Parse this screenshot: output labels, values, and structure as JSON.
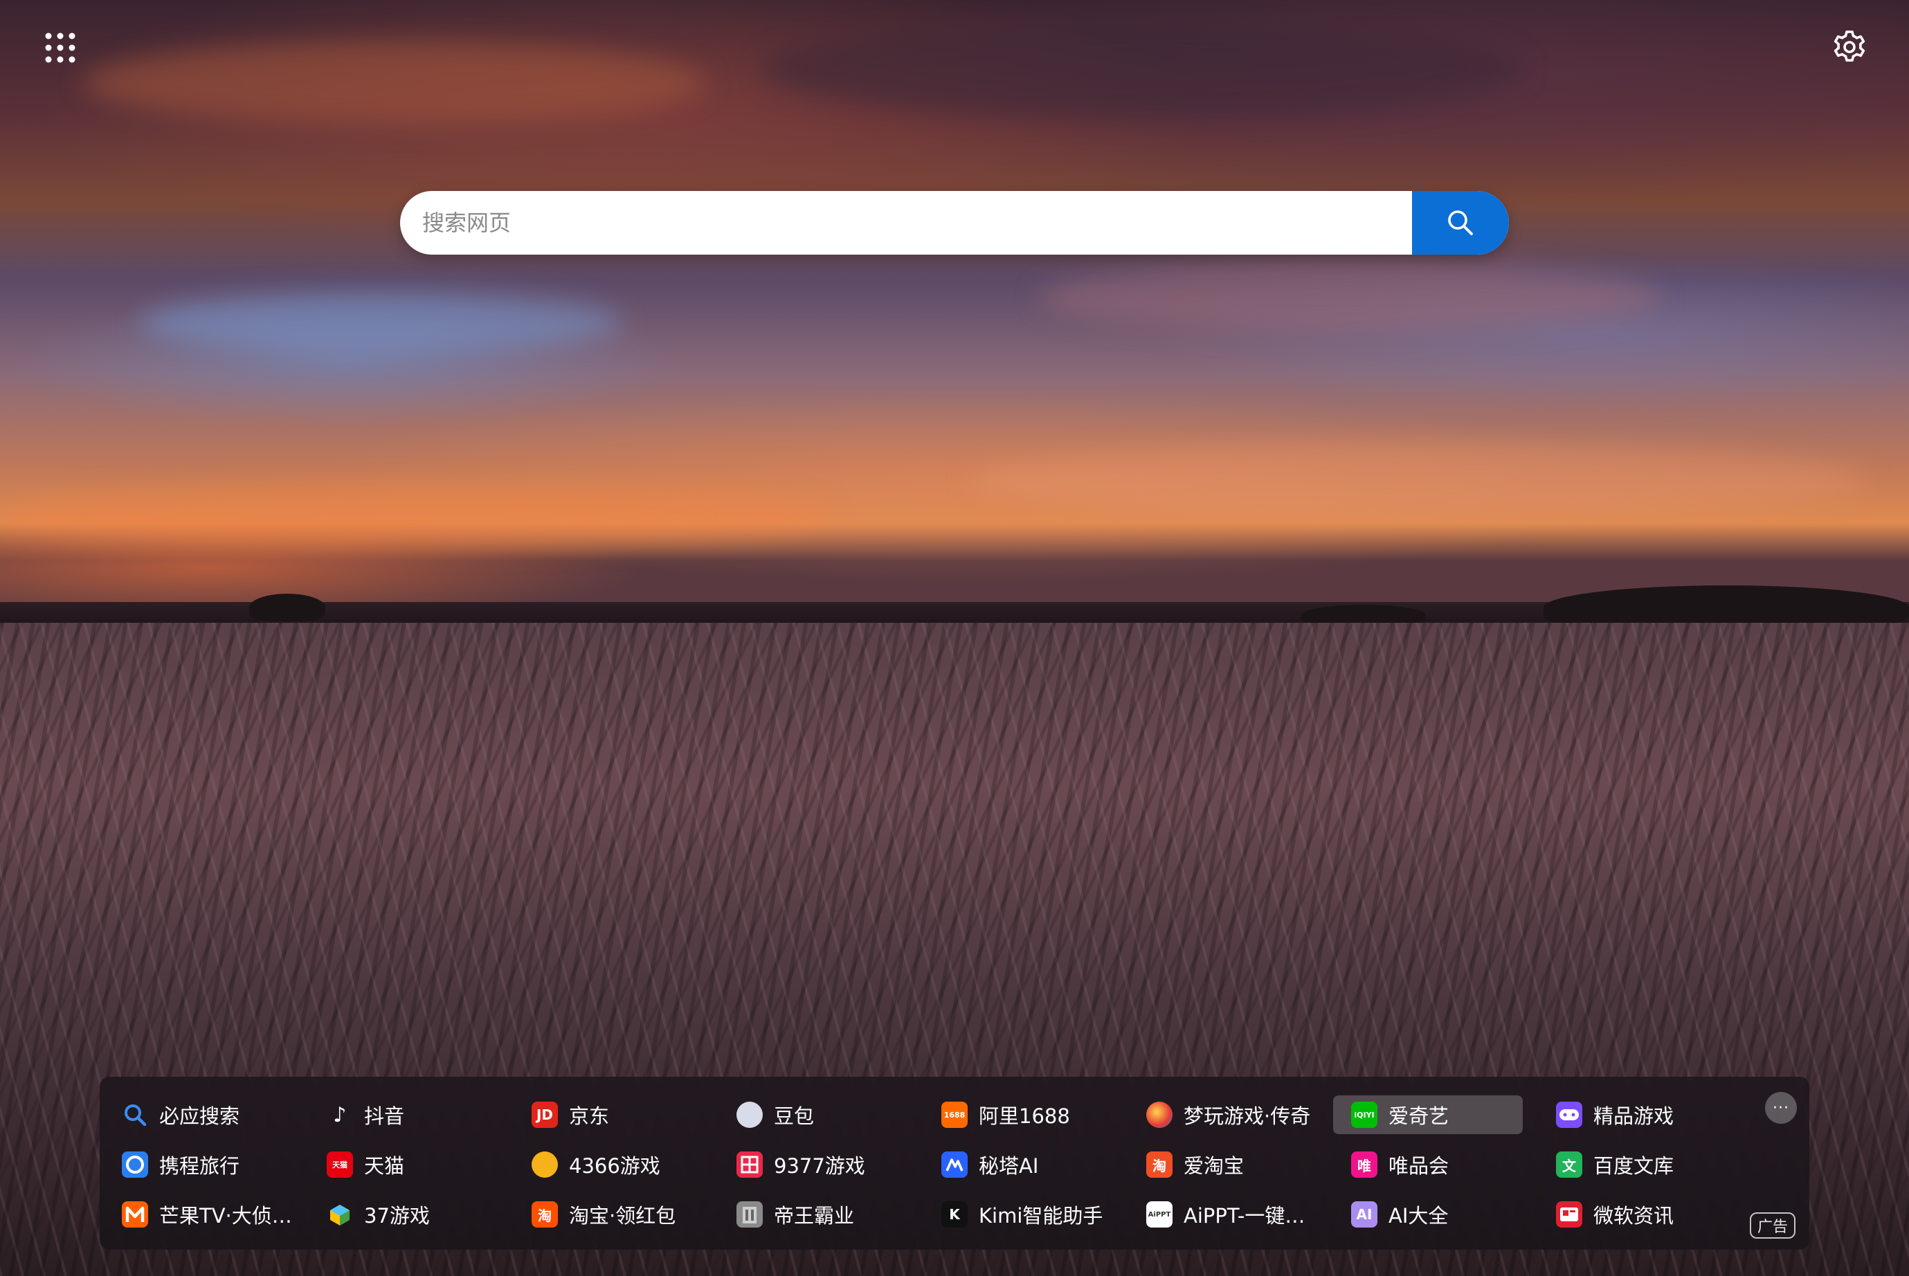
{
  "search": {
    "placeholder": "搜索网页"
  },
  "top": {
    "apps_icon": "grid-dots-icon",
    "settings_icon": "gear-icon"
  },
  "quick_links": [
    {
      "label": "必应搜索",
      "icon": "bing-search-icon",
      "icon_text": "",
      "color": "#1a73e8"
    },
    {
      "label": "抖音",
      "icon": "douyin-icon",
      "icon_text": "♪",
      "color": "#111111"
    },
    {
      "label": "京东",
      "icon": "jd-icon",
      "icon_text": "JD",
      "color": "#e1251b"
    },
    {
      "label": "豆包",
      "icon": "doubao-icon",
      "icon_text": "",
      "color": "#d8dbe8"
    },
    {
      "label": "阿里1688",
      "icon": "ali1688-icon",
      "icon_text": "1688",
      "color": "#ff6a00"
    },
    {
      "label": "梦玩游戏·传奇",
      "icon": "mengwan-icon",
      "icon_text": "",
      "color": "#e53935"
    },
    {
      "label": "爱奇艺",
      "icon": "iqiyi-icon",
      "icon_text": "iQIYI",
      "color": "#00be06"
    },
    {
      "label": "精品游戏",
      "icon": "gamepad-icon",
      "icon_text": "",
      "color": "#7c4dff"
    },
    {
      "label": "携程旅行",
      "icon": "ctrip-icon",
      "icon_text": "",
      "color": "#2a7ff0"
    },
    {
      "label": "天猫",
      "icon": "tmall-icon",
      "icon_text": "天猫",
      "color": "#e60012"
    },
    {
      "label": "4366游戏",
      "icon": "game4366-icon",
      "icon_text": "",
      "color": "#f6b21a"
    },
    {
      "label": "9377游戏",
      "icon": "game9377-icon",
      "icon_text": "",
      "color": "#e8294a"
    },
    {
      "label": "秘塔AI",
      "icon": "metaso-icon",
      "icon_text": "",
      "color": "#2962ff"
    },
    {
      "label": "爱淘宝",
      "icon": "aitaobao-icon",
      "icon_text": "淘",
      "color": "#f04e23"
    },
    {
      "label": "唯品会",
      "icon": "vip-icon",
      "icon_text": "唯",
      "color": "#f0148c"
    },
    {
      "label": "百度文库",
      "icon": "baiduwenku-icon",
      "icon_text": "文",
      "color": "#21b45a"
    },
    {
      "label": "芒果TV·大侦探...",
      "icon": "mgtv-icon",
      "icon_text": "",
      "color": "#ff5f00"
    },
    {
      "label": "37游戏",
      "icon": "game37-icon",
      "icon_text": "",
      "color": "#3aa0f0"
    },
    {
      "label": "淘宝·领红包",
      "icon": "taobao-icon",
      "icon_text": "淘",
      "color": "#ff5000"
    },
    {
      "label": "帝王霸业",
      "icon": "diwangbaye-icon",
      "icon_text": "",
      "color": "#8a8a8a"
    },
    {
      "label": "Kimi智能助手",
      "icon": "kimi-icon",
      "icon_text": "K",
      "color": "#111111"
    },
    {
      "label": "AiPPT-一键生成",
      "icon": "aippt-icon",
      "icon_text": "AiPPT",
      "color": "#ffffff"
    },
    {
      "label": "AI大全",
      "icon": "ai-daquan-icon",
      "icon_text": "AI",
      "color": "#a98df0"
    },
    {
      "label": "微软资讯",
      "icon": "msn-news-icon",
      "icon_text": "",
      "color": "#e02030"
    }
  ],
  "more": {
    "icon": "more-dots-icon",
    "text": "···"
  },
  "ad_label": "广告"
}
